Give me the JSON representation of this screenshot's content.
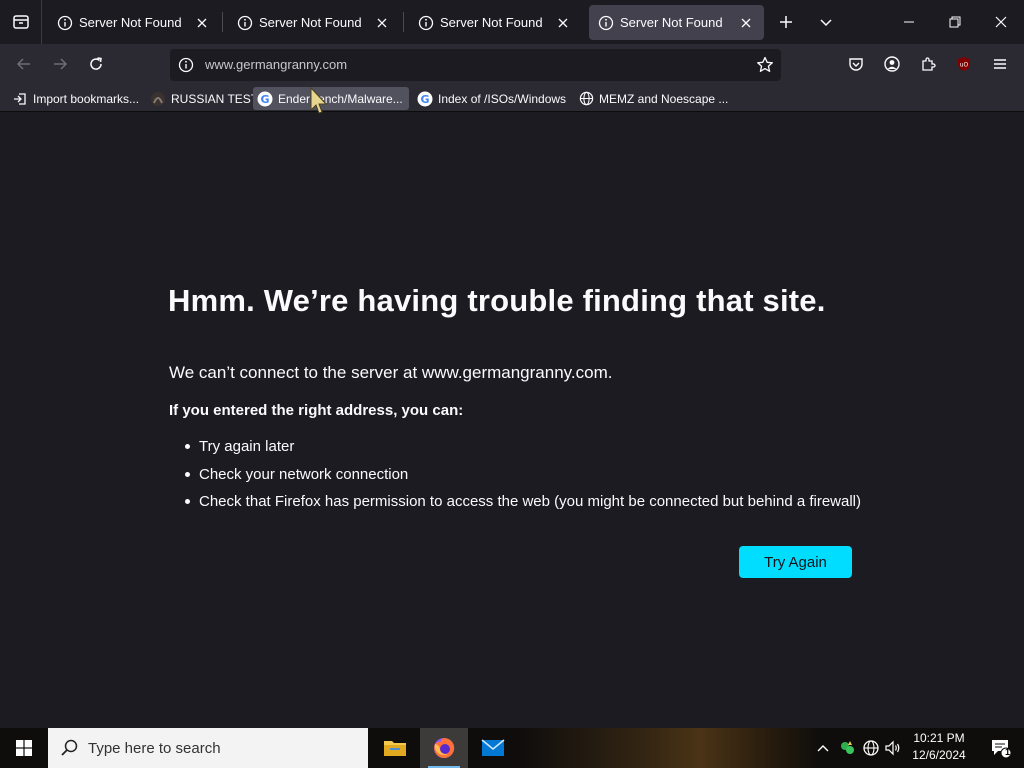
{
  "colors": {
    "accent": "#00ddff",
    "page_bg": "#1c1b22",
    "toolbar_bg": "#2b2a33",
    "active_tab_bg": "#42414d"
  },
  "tabs": [
    {
      "title": "Server Not Found",
      "icon": "info-icon",
      "active": false
    },
    {
      "title": "Server Not Found",
      "icon": "info-icon",
      "active": false
    },
    {
      "title": "Server Not Found",
      "icon": "info-icon",
      "active": false
    },
    {
      "title": "Server Not Found",
      "icon": "info-icon",
      "active": true
    }
  ],
  "urlbar": {
    "url": "www.germangranny.com"
  },
  "bookmarks": [
    {
      "label": "Import bookmarks...",
      "icon": "import-icon"
    },
    {
      "label": "RUSSIAN TEST",
      "icon": "dark-favicon"
    },
    {
      "label": "EnderBench/Malware...",
      "icon": "google-icon"
    },
    {
      "label": "Index of /ISOs/Windows",
      "icon": "google-icon"
    },
    {
      "label": "MEMZ and Noescape ...",
      "icon": "globe-icon"
    }
  ],
  "error": {
    "title": "Hmm. We’re having trouble finding that site.",
    "description": "We can’t connect to the server at www.germangranny.com.",
    "subheading": "If you entered the right address, you can:",
    "suggestions": [
      "Try again later",
      "Check your network connection",
      "Check that Firefox has permission to access the web (you might be connected but behind a firewall)"
    ],
    "button_label": "Try Again"
  },
  "taskbar": {
    "search_placeholder": "Type here to search",
    "time": "10:21 PM",
    "date": "12/6/2024",
    "notification_count": "1"
  }
}
